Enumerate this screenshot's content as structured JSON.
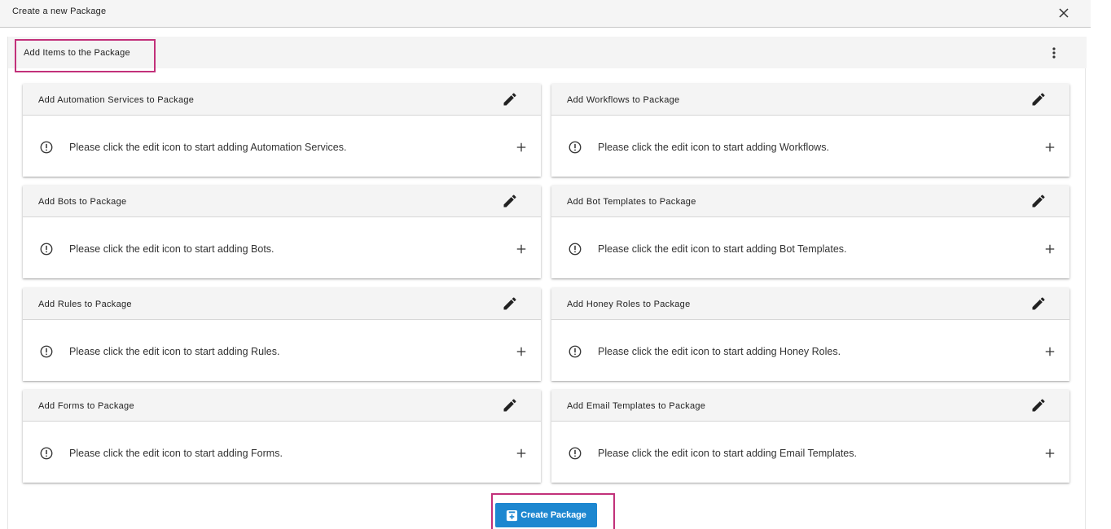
{
  "dialog": {
    "title": "Create a new Package"
  },
  "panel": {
    "title": "Add Items to the Package"
  },
  "cards": [
    {
      "title": "Add Automation Services to Package",
      "message": "Please click the edit icon to start adding Automation Services."
    },
    {
      "title": "Add Workflows to Package",
      "message": "Please click the edit icon to start adding Workflows."
    },
    {
      "title": "Add Bots to Package",
      "message": "Please click the edit icon to start adding Bots."
    },
    {
      "title": "Add Bot Templates to Package",
      "message": "Please click the edit icon to start adding Bot Templates."
    },
    {
      "title": "Add Rules to Package",
      "message": "Please click the edit icon to start adding Rules."
    },
    {
      "title": "Add Honey Roles to Package",
      "message": "Please click the edit icon to start adding Honey Roles."
    },
    {
      "title": "Add Forms to Package",
      "message": "Please click the edit icon to start adding Forms."
    },
    {
      "title": "Add Email Templates to Package",
      "message": "Please click the edit icon to start adding Email Templates."
    }
  ],
  "footer": {
    "create_label": "Create Package"
  },
  "icons": {
    "close": "close-icon",
    "menu": "more-vertical-icon",
    "edit": "pencil-icon",
    "info": "alert-circle-icon",
    "add": "plus-icon",
    "create": "add-box-icon"
  },
  "colors": {
    "accent": "#1d87d0",
    "highlight": "#c2317a",
    "header_bg": "#f4f4f4"
  }
}
